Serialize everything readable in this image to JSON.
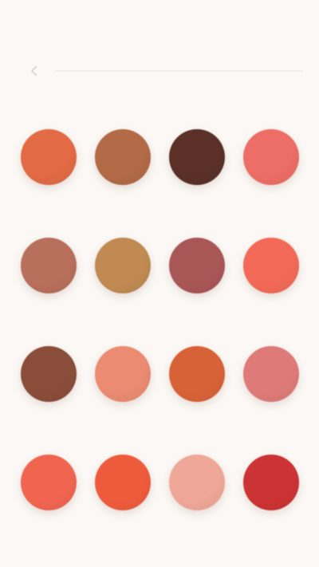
{
  "header": {
    "back_icon": "chevron-left-icon"
  },
  "swatches": [
    {
      "name": "",
      "color": "#e26a45"
    },
    {
      "name": "",
      "color": "#b26a47"
    },
    {
      "name": "",
      "color": "#5a3027"
    },
    {
      "name": "",
      "color": "#ec6e66"
    },
    {
      "name": "",
      "color": "#b86f5b"
    },
    {
      "name": "",
      "color": "#c08a52"
    },
    {
      "name": "",
      "color": "#a95657"
    },
    {
      "name": "",
      "color": "#f26a57"
    },
    {
      "name": "",
      "color": "#8a4d3a"
    },
    {
      "name": "",
      "color": "#ea8b72"
    },
    {
      "name": "",
      "color": "#d86237"
    },
    {
      "name": "",
      "color": "#de7b78"
    },
    {
      "name": "",
      "color": "#f06550"
    },
    {
      "name": "",
      "color": "#ee5b3c"
    },
    {
      "name": "",
      "color": "#efa797"
    },
    {
      "name": "",
      "color": "#cc3334"
    }
  ]
}
